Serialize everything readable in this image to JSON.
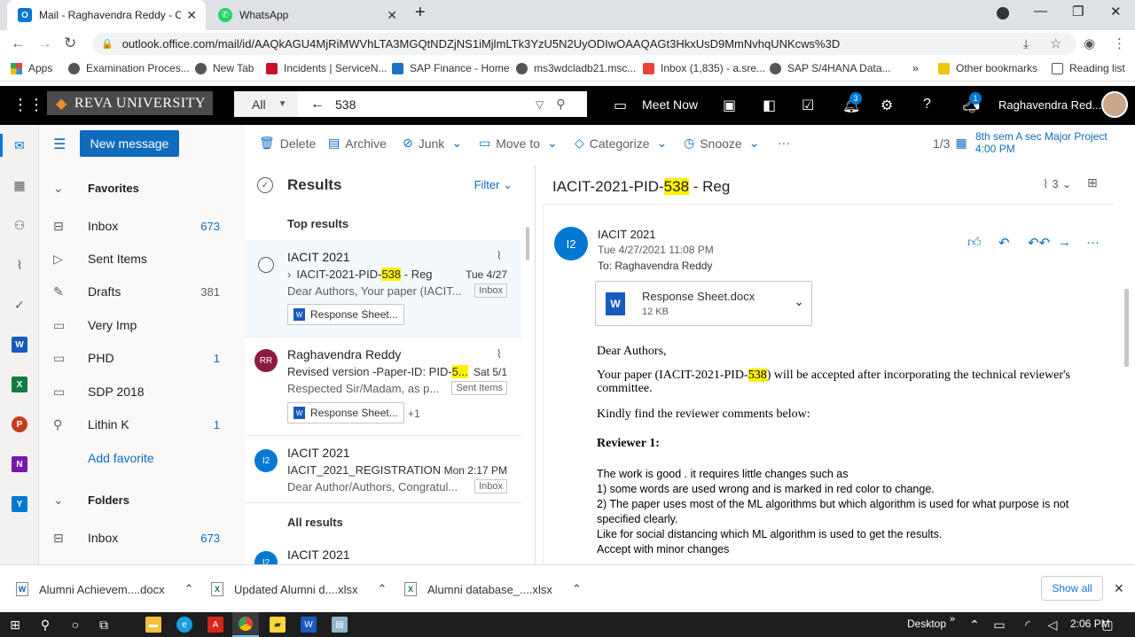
{
  "browser": {
    "tabs": [
      {
        "title": "Mail - Raghavendra Reddy - Outl",
        "icon": "outlook-icon"
      },
      {
        "title": "WhatsApp",
        "icon": "whatsapp-icon"
      }
    ],
    "new_tab": "+",
    "url": "outlook.office.com/mail/id/AAQkAGU4MjRiMWVhLTA3MGQtNDZjNS1iMjlmLTk3YzU5N2UyODIwOAAQAGt3HkxUsD9MmNvhqUNKcws%3D",
    "bookmarks": [
      "Apps",
      "Examination Proces...",
      "New Tab",
      "Incidents | ServiceN...",
      "SAP Finance - Home",
      "ms3wdcladb21.msc...",
      "Inbox (1,835) - a.sre...",
      "SAP S/4HANA Data..."
    ],
    "more": "»",
    "other_bookmarks": "Other bookmarks",
    "reading_list": "Reading list"
  },
  "header": {
    "org": "REVA UNIVERSITY",
    "search_scope": "All",
    "search_value": "538",
    "meet_now": "Meet Now",
    "notif_badge": "3",
    "feedback_badge": "1",
    "user": "Raghavendra Red..."
  },
  "folders": {
    "new_message": "New message",
    "favorites": "Favorites",
    "items": [
      {
        "label": "Inbox",
        "count": "673",
        "icon": "inbox-icon"
      },
      {
        "label": "Sent Items",
        "count": "",
        "icon": "send-icon"
      },
      {
        "label": "Drafts",
        "count": "381",
        "icon": "pencil-icon"
      },
      {
        "label": "Very Imp",
        "count": "",
        "icon": "folder-icon"
      },
      {
        "label": "PHD",
        "count": "1",
        "icon": "folder-icon"
      },
      {
        "label": "SDP 2018",
        "count": "",
        "icon": "folder-icon"
      },
      {
        "label": "Lithin K",
        "count": "1",
        "icon": "person-icon"
      }
    ],
    "add_favorite": "Add favorite",
    "folders_label": "Folders",
    "inbox2": {
      "label": "Inbox",
      "count": "673"
    }
  },
  "toolbar": {
    "delete": "Delete",
    "archive": "Archive",
    "junk": "Junk",
    "move_to": "Move to",
    "categorize": "Categorize",
    "snooze": "Snooze",
    "more": "···",
    "page": "1/3",
    "event_title": "8th sem A sec Major Project",
    "event_time": "4:00 PM"
  },
  "list": {
    "title": "Results",
    "filter": "Filter",
    "top_results": "Top results",
    "all_results": "All results",
    "messages": [
      {
        "from": "IACIT 2021",
        "subj_pre": "IACIT-2021-PID-",
        "subj_hl": "538",
        "subj_post": " - Reg",
        "date": "Tue 4/27",
        "preview": "Dear Authors, Your paper (IACIT...",
        "tag": "Inbox",
        "attachment": "Response Sheet..."
      },
      {
        "from": "Raghavendra Reddy",
        "initials": "RR",
        "subj_pre": "Revised version -Paper-ID: PID-",
        "subj_hl": "5...",
        "subj_post": "",
        "date": "Sat 5/1",
        "preview": "Respected Sir/Madam, as p...",
        "tag": "Sent Items",
        "attachment": "Response Sheet...",
        "extra": "+1"
      },
      {
        "from": "IACIT 2021",
        "initials": "I2",
        "subj_pre": "IACIT_2021_REGISTRATION",
        "subj_hl": "",
        "subj_post": "",
        "date": "Mon 2:17 PM",
        "preview": "Dear Author/Authors, Congratul...",
        "tag": "Inbox"
      },
      {
        "from": "IACIT 2021",
        "initials": "I2"
      }
    ]
  },
  "reading": {
    "subject_pre": "IACIT-2021-PID-",
    "subject_hl": "538",
    "subject_post": " - Reg",
    "attach_count": "3",
    "sender_initials": "I2",
    "sender": "IACIT 2021",
    "datetime": "Tue 4/27/2021 11:08 PM",
    "to_label": "To:",
    "to": "Raghavendra Reddy",
    "attachment_name": "Response Sheet.docx",
    "attachment_size": "12 KB",
    "greeting": "Dear Authors,",
    "para1_pre": "Your paper (IACIT-2021-PID-",
    "para1_hl": "538",
    "para1_post": ") will be accepted after incorporating the technical reviewer's committee.",
    "para2": "Kindly find the reviewer comments below:",
    "reviewer": "Reviewer 1:",
    "lines": [
      "The work is good . it requires little changes such as",
      "1) some words are used wrong and is marked in red color to change.",
      "2) The paper uses most of the ML algorithms but which algorithm is used for what purpose  is not specified clearly.",
      "Like for social distancing which ML algorithm is used to get the results.",
      "Accept with minor changes"
    ]
  },
  "downloads": {
    "items": [
      "Alumni Achievem....docx",
      "Updated Alumni d....xlsx",
      "Alumni database_....xlsx"
    ],
    "show_all": "Show all"
  },
  "taskbar": {
    "desktop": "Desktop",
    "time": "2:06 PM",
    "chev": "»"
  }
}
